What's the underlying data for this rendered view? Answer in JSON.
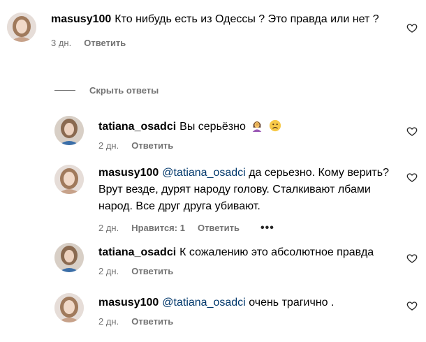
{
  "comments": [
    {
      "username": "masusy100",
      "mention": "",
      "text": "Кто нибудь есть из Одессы ? Это правда или нет ?",
      "time": "3 дн.",
      "likes": "",
      "reply_label": "Ответить"
    },
    {
      "username": "tatiana_osadci",
      "mention": "",
      "text": "Вы серьёзно",
      "emojis": [
        "woman-facepalming",
        "disappointed-face"
      ],
      "time": "2 дн.",
      "likes": "",
      "reply_label": "Ответить"
    },
    {
      "username": "masusy100",
      "mention": "@tatiana_osadci",
      "text": "да серьезно. Кому верить? Врут везде, дурят народу голову. Сталкивают лбами народ. Все друг друга убивают.",
      "time": "2 дн.",
      "likes": "Нравится: 1",
      "reply_label": "Ответить",
      "more": "•••"
    },
    {
      "username": "tatiana_osadci",
      "mention": "",
      "text": "К сожалению это абсолютное правда",
      "time": "2 дн.",
      "likes": "",
      "reply_label": "Ответить"
    },
    {
      "username": "masusy100",
      "mention": "@tatiana_osadci",
      "text": "очень трагично .",
      "time": "2 дн.",
      "likes": "",
      "reply_label": "Ответить"
    }
  ],
  "hide_replies_label": "Скрыть ответы",
  "colors": {
    "meta": "#737373",
    "mention": "#00376b"
  }
}
